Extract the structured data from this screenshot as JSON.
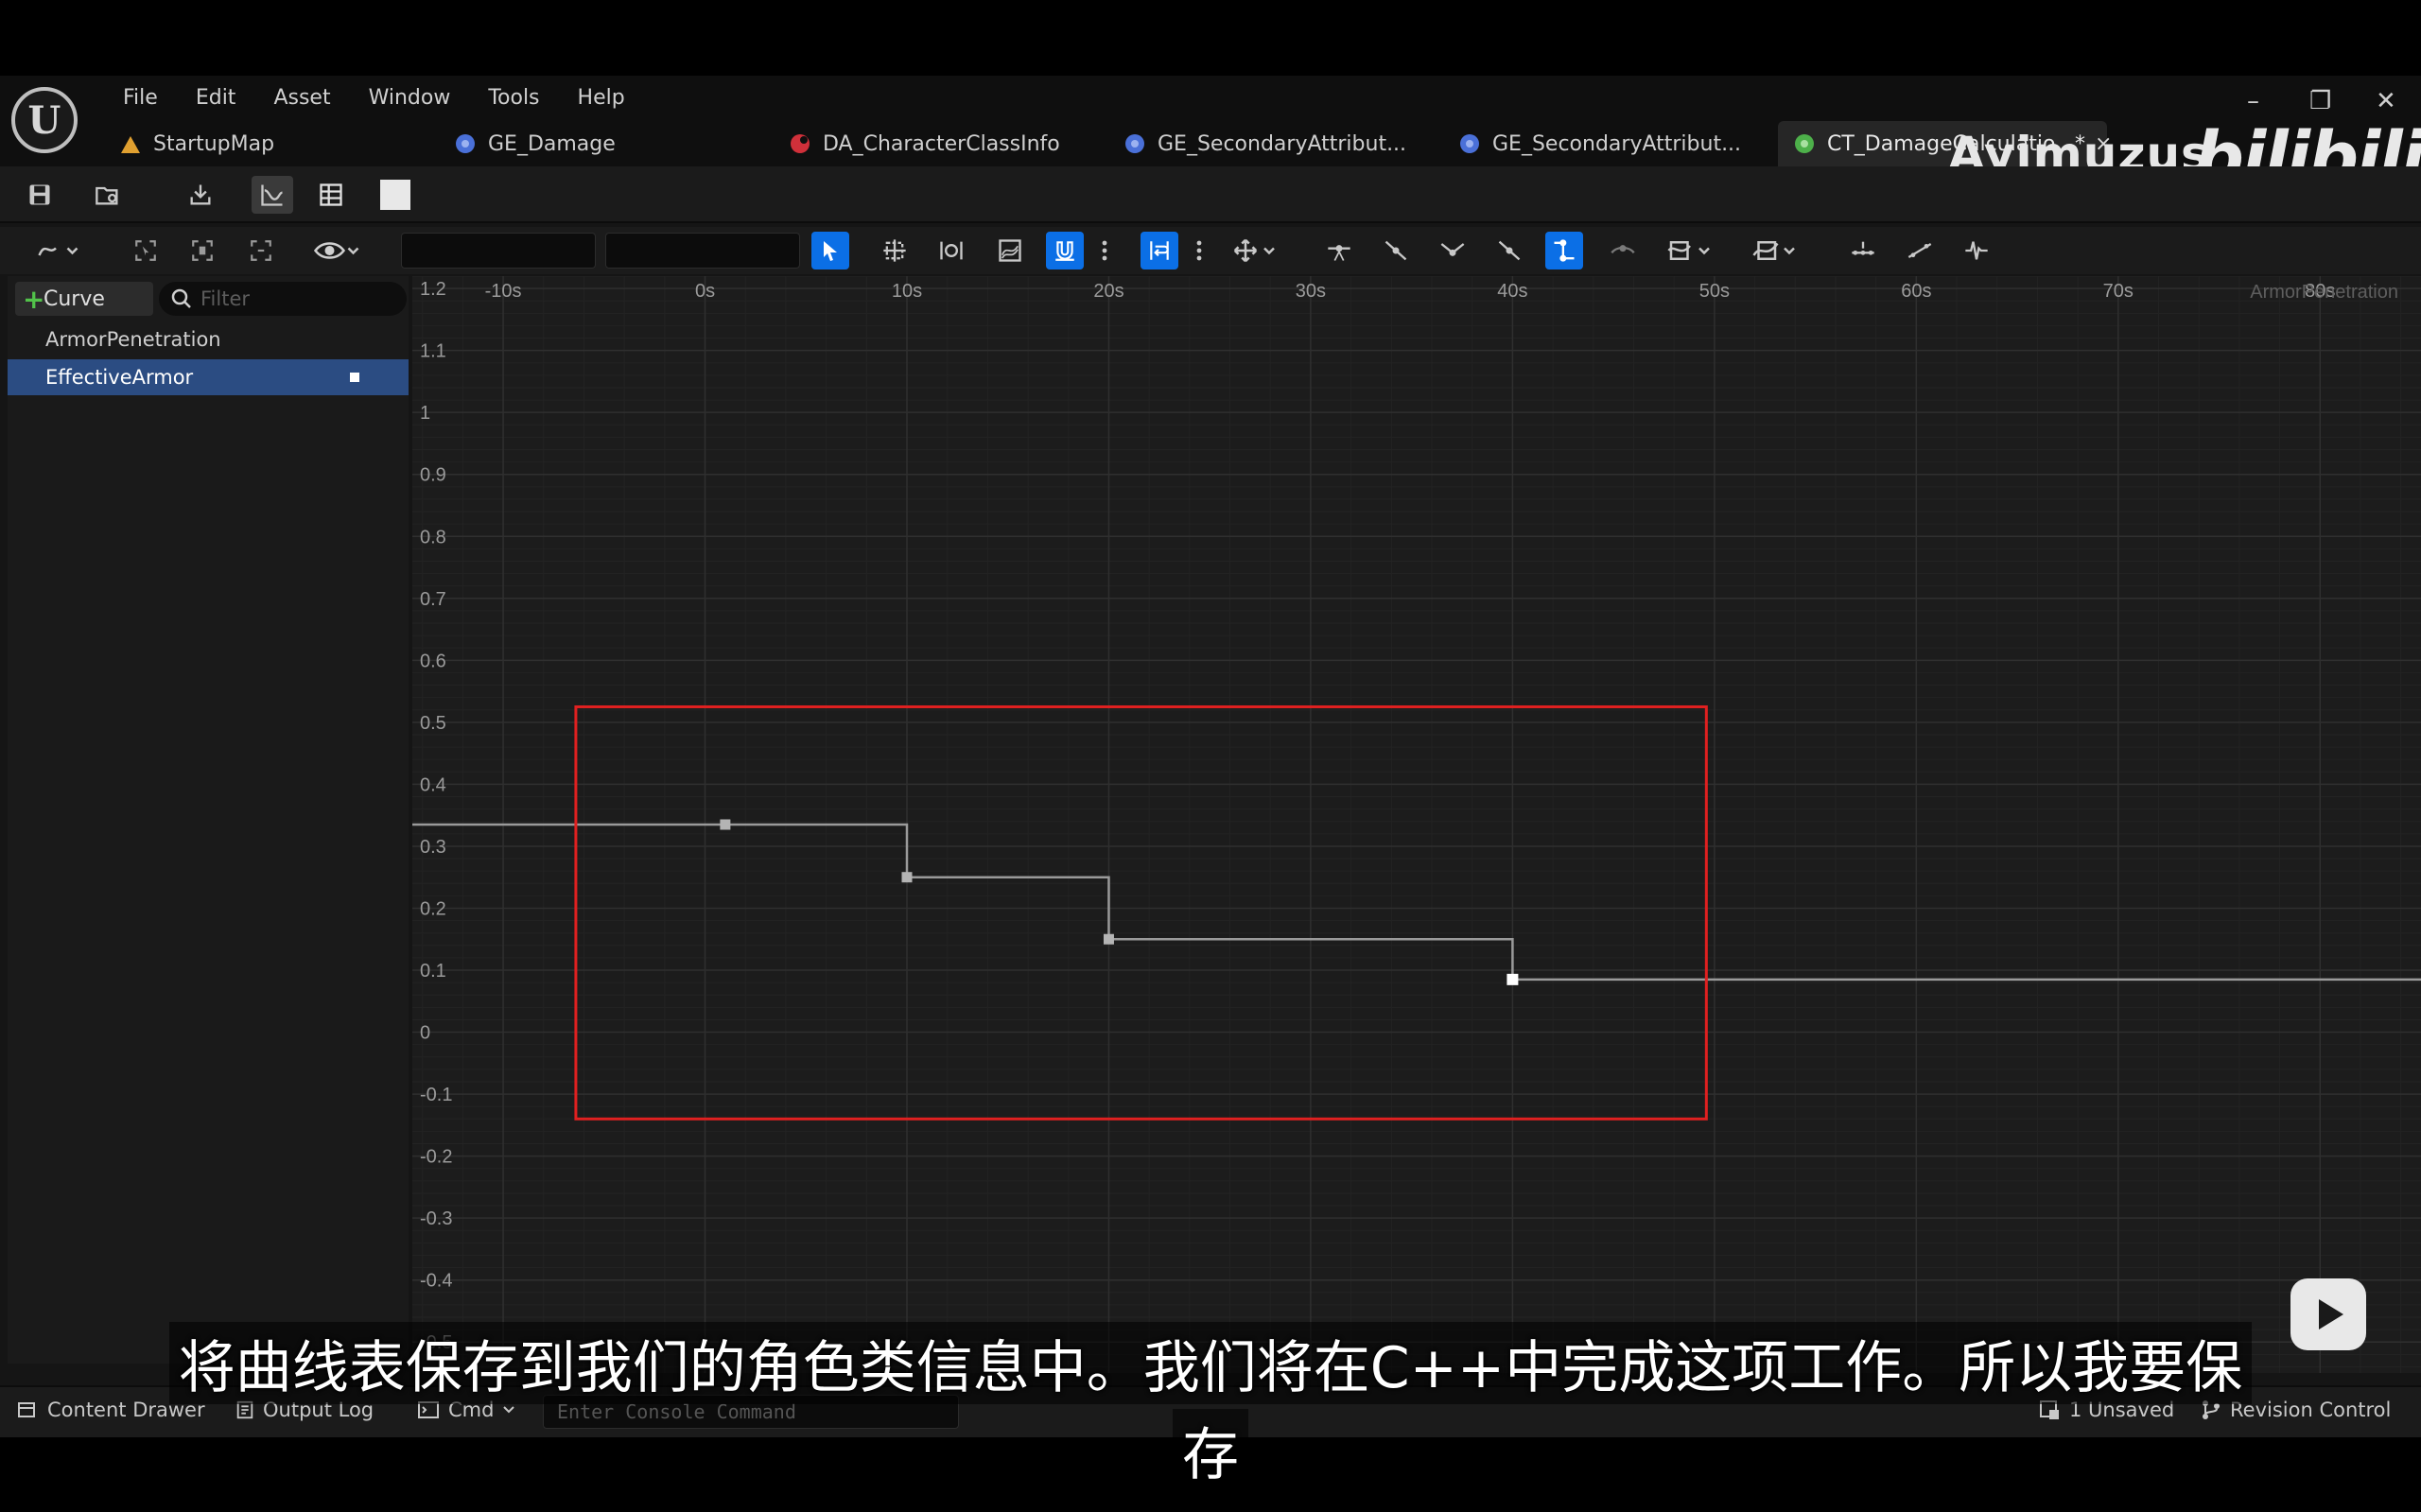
{
  "menu": [
    "File",
    "Edit",
    "Asset",
    "Window",
    "Tools",
    "Help"
  ],
  "tabs": [
    {
      "label": "StartupMap",
      "icon": "level-icon",
      "color": "#e0a030"
    },
    {
      "label": "GE_Damage",
      "icon": "gameplay-effect-icon",
      "color": "#4a70d8"
    },
    {
      "label": "DA_CharacterClassInfo",
      "icon": "data-asset-icon",
      "color": "#d0303a"
    },
    {
      "label": "GE_SecondaryAttribut...",
      "icon": "gameplay-effect-icon",
      "color": "#4a70d8"
    },
    {
      "label": "GE_SecondaryAttribut...",
      "icon": "gameplay-effect-icon",
      "color": "#4a70d8"
    },
    {
      "label": "CT_DamageCalculatio...*",
      "icon": "curve-table-icon",
      "color": "#4db04a",
      "active": true
    }
  ],
  "tab_close": "×",
  "window_controls": {
    "minimize": "–",
    "restore": "❐",
    "close": "✕"
  },
  "watermark": {
    "name": "Ayimuzus",
    "logo": "bilibili"
  },
  "left_panel": {
    "add_curve_label": "Curve",
    "filter_placeholder": "Filter",
    "curves": [
      {
        "label": "ArmorPenetration",
        "selected": false
      },
      {
        "label": "EffectiveArmor",
        "selected": true
      }
    ]
  },
  "graph": {
    "curve_name_label": "ArmorPenetration",
    "x_ticks": [
      "-10s",
      "0s",
      "10s",
      "20s",
      "30s",
      "40s",
      "50s",
      "60s",
      "70s",
      "80s"
    ],
    "y_ticks": [
      "1.2",
      "1.1",
      "1",
      "0.9",
      "0.8",
      "0.7",
      "0.6",
      "0.5",
      "0.4",
      "0.3",
      "0.2",
      "0.1",
      "0",
      "-0.1",
      "-0.2",
      "-0.3",
      "-0.4",
      "-0.5"
    ],
    "highlight_color": "#e02020"
  },
  "chart_data": {
    "type": "line",
    "interpolation": "step",
    "series": [
      {
        "name": "EffectiveArmor",
        "x": [
          1,
          10,
          20,
          40
        ],
        "y": [
          0.335,
          0.25,
          0.15,
          0.085
        ]
      }
    ],
    "xlim": [
      -14.5,
      85
    ],
    "ylim": [
      -0.55,
      1.22
    ],
    "highlight_box": {
      "x": [
        -6.4,
        49.6
      ],
      "y": [
        -0.14,
        0.525
      ]
    }
  },
  "statusbar": {
    "content_drawer": "Content Drawer",
    "output_log": "Output Log",
    "cmd": "Cmd",
    "console_placeholder": "Enter Console Command",
    "unsaved": "1 Unsaved",
    "revision_control": "Revision Control"
  },
  "subtitle": {
    "line1": "将曲线表保存到我们的角色类信息中。我们将在C++中完成这项工作。所以我要保",
    "line2": "存"
  }
}
